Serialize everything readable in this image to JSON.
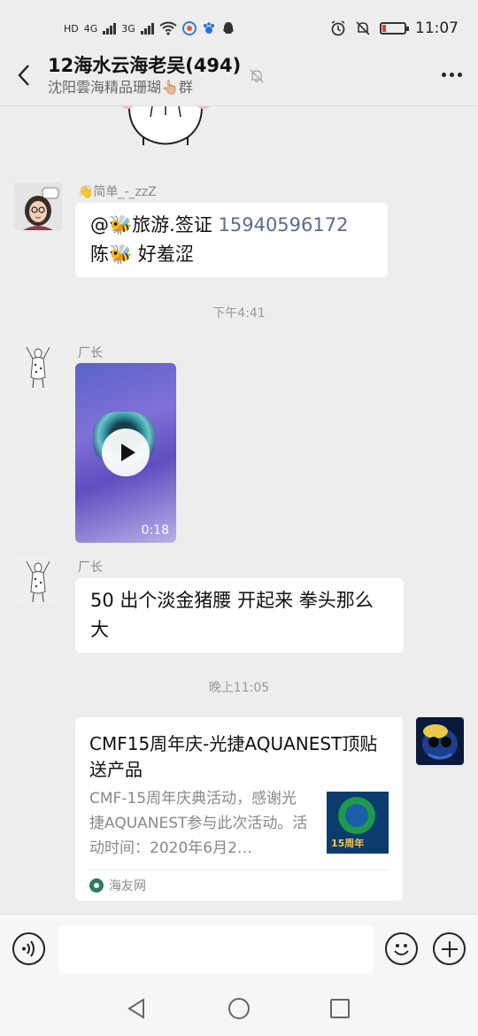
{
  "status_bar": {
    "network_labels": [
      "HD",
      "4G",
      "3G"
    ],
    "time": "11:07",
    "battery_level": 0.15
  },
  "header": {
    "title": "12海水云海老吴(494)",
    "subtitle": "沈阳雲海精品珊瑚👆🏼群"
  },
  "messages": [
    {
      "sender": "👋简单_-_zzZ",
      "text_prefix": "@🐝旅游.签证 ",
      "phone": "15940596172",
      "text_suffix": " 陈🐝 好羞涩"
    },
    {
      "timestamp": "下午4:41"
    },
    {
      "sender": "厂长",
      "video_duration": "0:18"
    },
    {
      "sender": "厂长",
      "text": "50 出个淡金猪腰 开起来 拳头那么大"
    },
    {
      "timestamp": "晚上11:05"
    },
    {
      "link_title": "CMF15周年庆-光捷AQUANEST顶贴送产品",
      "link_description": "CMF-15周年庆典活动，感谢光捷AQUANEST参与此次活动。活动时间：2020年6月2…",
      "thumbnail_badge": "15周年",
      "link_source": "海友网"
    }
  ],
  "icons": {
    "back": "chevron-left-icon",
    "mute": "bell-off-icon",
    "more": "more-horizontal-icon",
    "voice": "voice-icon",
    "emoji": "emoji-icon",
    "plus": "plus-icon"
  },
  "colors": {
    "background": "#ededed",
    "bubble": "#ffffff",
    "link_text": "#576b95",
    "meta_text": "#888888"
  }
}
